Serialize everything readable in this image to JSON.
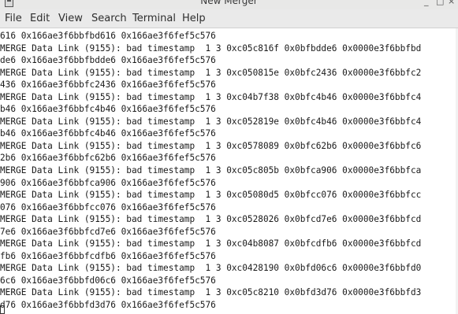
{
  "window": {
    "title": "New Merger",
    "minimize_glyph": "_",
    "maximize_glyph": "□",
    "close_glyph": "×"
  },
  "menu": {
    "items": [
      "File",
      "Edit",
      "View",
      "Search",
      "Terminal",
      "Help"
    ]
  },
  "terminal": {
    "lines": [
      "616 0x166ae3f6bbfbd616 0x166ae3f6fef5c576",
      "MERGE Data Link (9155): bad timestamp  1 3 0xc05c816f 0x0bfbdde6 0x0000e3f6bbfbd",
      "de6 0x166ae3f6bbfbdde6 0x166ae3f6fef5c576",
      "MERGE Data Link (9155): bad timestamp  1 3 0xc050815e 0x0bfc2436 0x0000e3f6bbfc2",
      "436 0x166ae3f6bbfc2436 0x166ae3f6fef5c576",
      "MERGE Data Link (9155): bad timestamp  1 3 0xc04b7f38 0x0bfc4b46 0x0000e3f6bbfc4",
      "b46 0x166ae3f6bbfc4b46 0x166ae3f6fef5c576",
      "MERGE Data Link (9155): bad timestamp  1 3 0xc052819e 0x0bfc4b46 0x0000e3f6bbfc4",
      "b46 0x166ae3f6bbfc4b46 0x166ae3f6fef5c576",
      "MERGE Data Link (9155): bad timestamp  1 3 0xc0578089 0x0bfc62b6 0x0000e3f6bbfc6",
      "2b6 0x166ae3f6bbfc62b6 0x166ae3f6fef5c576",
      "MERGE Data Link (9155): bad timestamp  1 3 0xc05c805b 0x0bfca906 0x0000e3f6bbfca",
      "906 0x166ae3f6bbfca906 0x166ae3f6fef5c576",
      "MERGE Data Link (9155): bad timestamp  1 3 0xc05080d5 0x0bfcc076 0x0000e3f6bbfcc",
      "076 0x166ae3f6bbfcc076 0x166ae3f6fef5c576",
      "MERGE Data Link (9155): bad timestamp  1 3 0xc0528026 0x0bfcd7e6 0x0000e3f6bbfcd",
      "7e6 0x166ae3f6bbfcd7e6 0x166ae3f6fef5c576",
      "MERGE Data Link (9155): bad timestamp  1 3 0xc04b8087 0x0bfcdfb6 0x0000e3f6bbfcd",
      "fb6 0x166ae3f6bbfcdfb6 0x166ae3f6fef5c576",
      "MERGE Data Link (9155): bad timestamp  1 3 0xc0428190 0x0bfd06c6 0x0000e3f6bbfd0",
      "6c6 0x166ae3f6bbfd06c6 0x166ae3f6fef5c576",
      "MERGE Data Link (9155): bad timestamp  1 3 0xc05c8210 0x0bfd3d76 0x0000e3f6bbfd3",
      "d76 0x166ae3f6bbfd3d76 0x166ae3f6fef5c576"
    ]
  }
}
